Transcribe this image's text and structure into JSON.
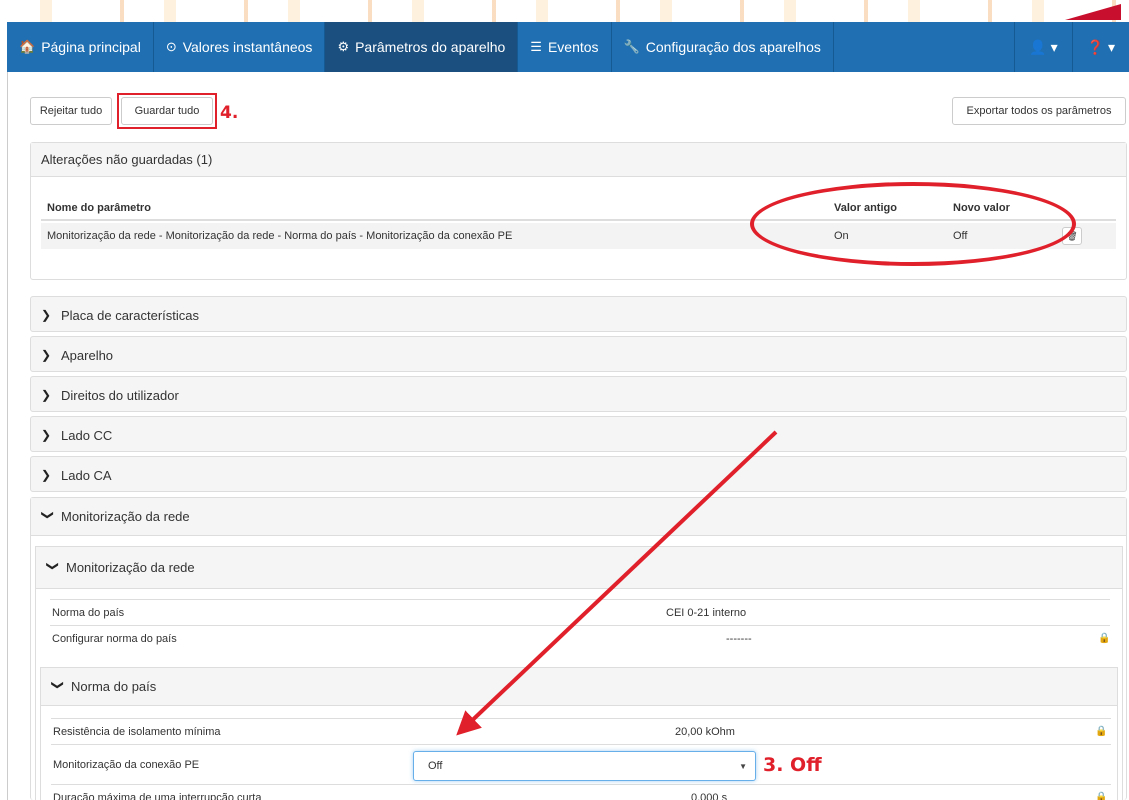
{
  "nav": {
    "items": [
      {
        "icon": "home-icon",
        "glyph": "🏠",
        "label": "Página principal"
      },
      {
        "icon": "gauge-icon",
        "glyph": "⊙",
        "label": "Valores instantâneos"
      },
      {
        "icon": "gear-icon",
        "glyph": "⚙",
        "label": "Parâmetros do aparelho"
      },
      {
        "icon": "list-icon",
        "glyph": "☰",
        "label": "Eventos"
      },
      {
        "icon": "wrench-icon",
        "glyph": "🔧",
        "label": "Configuração dos aparelhos"
      }
    ],
    "user_glyph": "👤 ▾",
    "help_glyph": "❓ ▾"
  },
  "toolbar": {
    "reject_label": "Rejeitar tudo",
    "save_label": "Guardar tudo",
    "export_label": "Exportar todos os parâmetros"
  },
  "annotations": {
    "step4": "4.",
    "step3": "3. Off"
  },
  "unsaved": {
    "title": "Alterações não guardadas (1)",
    "headers": {
      "name": "Nome do parâmetro",
      "old": "Valor antigo",
      "new": "Novo valor"
    },
    "row": {
      "name": "Monitorização da rede - Monitorização da rede - Norma do país - Monitorização da conexão PE",
      "old": "On",
      "new": "Off"
    }
  },
  "sections": [
    "Placa de características",
    "Aparelho",
    "Direitos do utilizador",
    "Lado CC",
    "Lado CA"
  ],
  "grid_monitoring": {
    "title": "Monitorização da rede",
    "sub_title": "Monitorização da rede",
    "rows": [
      {
        "label": "Norma do país",
        "value": "CEI 0-21 interno",
        "locked": false
      },
      {
        "label": "Configurar norma do país",
        "value": "-------",
        "locked": true
      }
    ],
    "country_norm": {
      "title": "Norma do país",
      "rows": [
        {
          "label": "Resistência de isolamento mínima",
          "value": "20,00 kOhm",
          "locked": true
        },
        {
          "label": "Monitorização da conexão PE",
          "value": "Off"
        },
        {
          "label": "Duração máxima de uma interrupção curta",
          "value": "0,000 s",
          "locked": true
        }
      ]
    }
  },
  "colors": {
    "nav": "#1f6fb2",
    "nav_active": "#1a4f7f",
    "annotation": "#e0202a"
  }
}
